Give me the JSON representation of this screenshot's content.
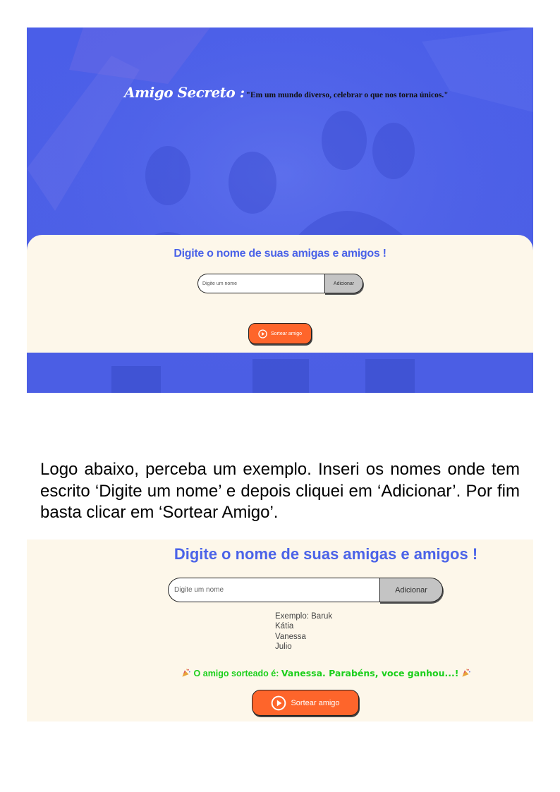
{
  "hero": {
    "brand": "Amigo Secreto :",
    "motto": "\"Em um mundo diverso, celebrar o que nos torna únicos.\""
  },
  "form_small": {
    "heading": "Digite o nome de suas amigas e amigos !",
    "input_placeholder": "Digite um nome",
    "add_label": "Adicionar",
    "draw_label": "Sortear amigo"
  },
  "paragraph": "Logo abaixo, perceba um exemplo. Inseri os nomes onde tem escrito ‘Digite um nome’ e depois cliquei em ‘Adicionar’. Por fim basta clicar em ‘Sortear Amigo’.",
  "form_example": {
    "heading": "Digite o nome de suas amigas e amigos !",
    "input_placeholder": "Digite um nome",
    "add_label": "Adicionar",
    "names": [
      "Exemplo: Baruk",
      "Kátia",
      "Vanessa",
      "Julio"
    ],
    "result_prefix": "O amigo sorteado é: ",
    "result_winner": "Vanessa. Parabéns, voce ganhou...!",
    "draw_label": "Sortear amigo"
  },
  "colors": {
    "hero_blue": "#4a5ee8",
    "card_bg": "#fdf7ea",
    "heading_blue": "#4b63e8",
    "button_orange": "#fe652b",
    "result_green": "#1bcf1b"
  }
}
